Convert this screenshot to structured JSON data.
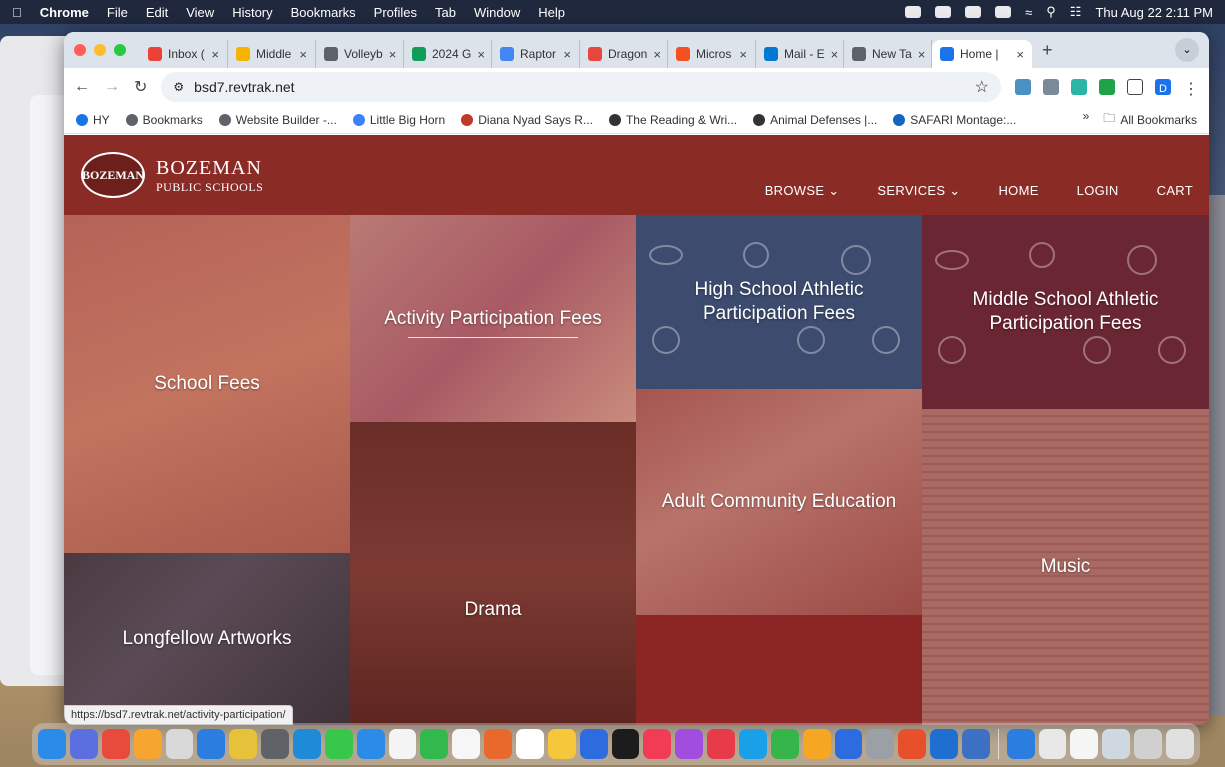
{
  "menubar": {
    "app": "Chrome",
    "items": [
      "File",
      "Edit",
      "View",
      "History",
      "Bookmarks",
      "Profiles",
      "Tab",
      "Window",
      "Help"
    ],
    "clock": "Thu Aug 22  2:11 PM"
  },
  "tabs": [
    {
      "label": "Inbox (",
      "color": "#ea4335"
    },
    {
      "label": "Middle",
      "color": "#f4b400"
    },
    {
      "label": "Volleyb",
      "color": "#5f6368"
    },
    {
      "label": "2024 G",
      "color": "#0f9d58"
    },
    {
      "label": "Raptor",
      "color": "#4285f4"
    },
    {
      "label": "Dragon",
      "color": "#e8453c"
    },
    {
      "label": "Micros",
      "color": "#f25022"
    },
    {
      "label": "Mail - E",
      "color": "#0078d4"
    },
    {
      "label": "New Ta",
      "color": "#5f6368"
    },
    {
      "label": "Home |",
      "color": "#1a73e8",
      "active": true
    }
  ],
  "url": "bsd7.revtrak.net",
  "avatar_letter": "D",
  "bookmarks": [
    {
      "label": "HY",
      "color": "#1a73e8"
    },
    {
      "label": "Bookmarks",
      "color": "#5f6368"
    },
    {
      "label": "Website Builder -...",
      "color": "#5f6368"
    },
    {
      "label": "Little Big Horn",
      "color": "#3b82f6"
    },
    {
      "label": "Diana Nyad Says R...",
      "color": "#c0392b"
    },
    {
      "label": "The Reading & Wri...",
      "color": "#333333"
    },
    {
      "label": "Animal Defenses |...",
      "color": "#333333"
    },
    {
      "label": "SAFARI Montage:...",
      "color": "#1565c0"
    }
  ],
  "all_bookmarks": "All Bookmarks",
  "site": {
    "logo_text": "BOZEMAN",
    "brand_line1": "BOZEMAN",
    "brand_line2": "PUBLIC SCHOOLS",
    "nav": [
      "BROWSE",
      "SERVICES",
      "HOME",
      "LOGIN",
      "CART"
    ],
    "accent": "#8b2b26",
    "tiles": [
      "School Fees",
      "Activity Participation Fees",
      "High School Athletic Participation Fees",
      "Middle School Athletic Participation Fees",
      "Adult Community Education",
      "Drama",
      "Music",
      "Longfellow Artworks"
    ]
  },
  "status_url": "https://bsd7.revtrak.net/activity-participation/"
}
